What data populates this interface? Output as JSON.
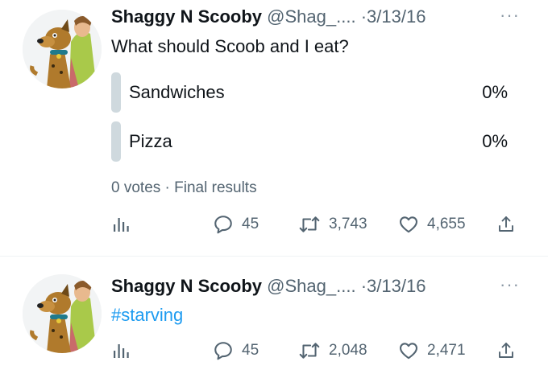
{
  "tweets": [
    {
      "author_name": "Shaggy N Scooby",
      "handle": "@Shag_....",
      "separator": "·",
      "date": "3/13/16",
      "more_label": "···",
      "text": "What should Scoob and I eat?",
      "poll": {
        "options": [
          {
            "label": "Sandwiches",
            "percent": "0%"
          },
          {
            "label": "Pizza",
            "percent": "0%"
          }
        ],
        "votes": "0 votes",
        "status": "Final results",
        "meta_separator": "·"
      },
      "stats": {
        "replies": "45",
        "retweets": "3,743",
        "likes": "4,655"
      }
    },
    {
      "author_name": "Shaggy N Scooby",
      "handle": "@Shag_....",
      "separator": "·",
      "date": "3/13/16",
      "more_label": "···",
      "text": "#starving",
      "stats": {
        "replies": "45",
        "retweets": "2,048",
        "likes": "2,471"
      }
    }
  ],
  "icons": {
    "analytics": "analytics-icon",
    "reply": "reply-icon",
    "retweet": "retweet-icon",
    "like": "like-icon",
    "share": "share-icon",
    "more": "more-icon"
  },
  "colors": {
    "text": "#0f1419",
    "secondary": "#536471",
    "hashtag": "#1d9bf0",
    "poll_bar": "#cfd9de",
    "divider": "#eff3f4"
  }
}
